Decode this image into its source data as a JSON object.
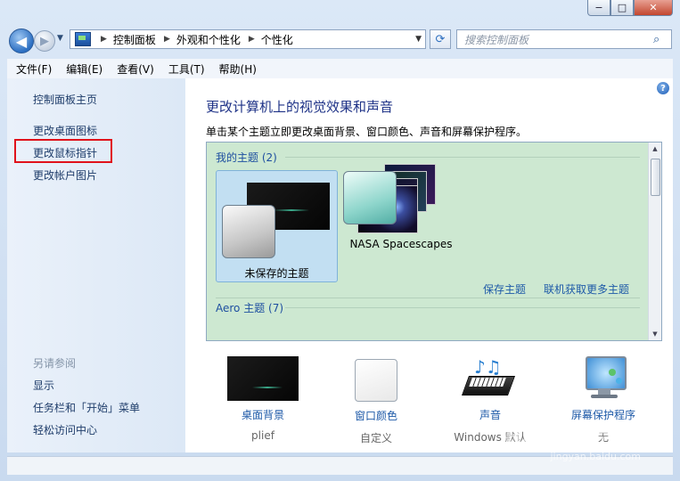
{
  "window": {
    "min_glyph": "−",
    "max_glyph": "□",
    "close_glyph": "✕"
  },
  "nav": {
    "back_glyph": "◀",
    "forward_glyph": "▶",
    "breadcrumbs": [
      "控制面板",
      "外观和个性化",
      "个性化"
    ],
    "refresh_glyph": "⟳",
    "search_placeholder": "搜索控制面板"
  },
  "menu": [
    "文件(F)",
    "编辑(E)",
    "查看(V)",
    "工具(T)",
    "帮助(H)"
  ],
  "left": {
    "home": "控制面板主页",
    "links": [
      "更改桌面图标",
      "更改鼠标指针",
      "更改帐户图片"
    ],
    "see_also_title": "另请参阅",
    "see_also": [
      "显示",
      "任务栏和「开始」菜单",
      "轻松访问中心"
    ]
  },
  "main": {
    "heading": "更改计算机上的视觉效果和声音",
    "subtitle": "单击某个主题立即更改桌面背景、窗口颜色、声音和屏幕保护程序。",
    "my_themes_label": "我的主题 (2)",
    "themes": [
      {
        "label": "未保存的主题"
      },
      {
        "label": "NASA Spacescapes"
      }
    ],
    "save_theme": "保存主题",
    "more_themes": "联机获取更多主题",
    "aero_label": "Aero 主题 (7)",
    "bottom": [
      {
        "title": "桌面背景",
        "value": "plief"
      },
      {
        "title": "窗口颜色",
        "value": "自定义"
      },
      {
        "title": "声音",
        "value": "Windows 默认"
      },
      {
        "title": "屏幕保护程序",
        "value": "无"
      }
    ],
    "help_glyph": "?"
  },
  "watermark": {
    "main": "Baidu 经验",
    "sub": "jingyan.baidu.com"
  }
}
